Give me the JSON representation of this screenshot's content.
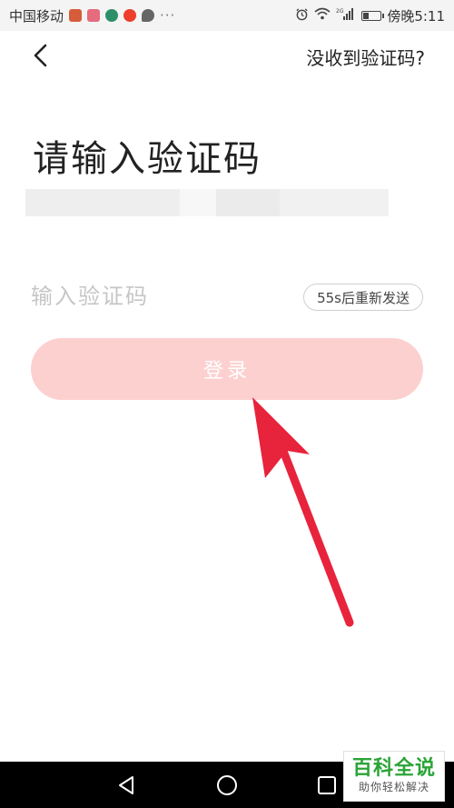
{
  "status_bar": {
    "carrier": "中国移动",
    "overflow": "···",
    "network_label": "2G",
    "time": "傍晚5:11",
    "battery_level": 0.3,
    "app_icons": [
      "app-icon",
      "app-icon",
      "app-icon",
      "app-icon",
      "chat-icon"
    ]
  },
  "header": {
    "back_icon": "chevron-left-icon",
    "help_link": "没收到验证码?"
  },
  "main": {
    "title": "请输入验证码",
    "code_input": {
      "placeholder": "输入验证码",
      "value": ""
    },
    "resend_label": "55s后重新发送",
    "login_label": "登录"
  },
  "colors": {
    "login_bg": "#fdd0d0",
    "arrow": "#e8233c",
    "watermark_green": "#2aa436"
  },
  "nav_bar": {
    "icons": [
      "back-triangle-icon",
      "home-circle-icon",
      "recent-square-icon"
    ]
  },
  "watermark": {
    "title": "百科全说",
    "subtitle": "助你轻松解决"
  }
}
